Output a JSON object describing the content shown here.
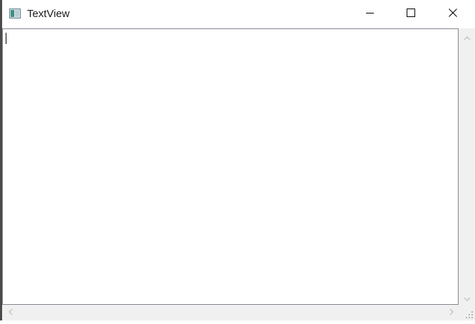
{
  "window": {
    "title": "TextView",
    "app_icon": "app-window-icon"
  },
  "caption_buttons": {
    "minimize_icon": "minimize-icon",
    "maximize_icon": "maximize-icon",
    "close_icon": "close-icon"
  },
  "editor": {
    "text": ""
  },
  "scrollbars": {
    "up_icon": "chevron-up-icon",
    "down_icon": "chevron-down-icon",
    "left_icon": "chevron-left-icon",
    "right_icon": "chevron-right-icon"
  }
}
